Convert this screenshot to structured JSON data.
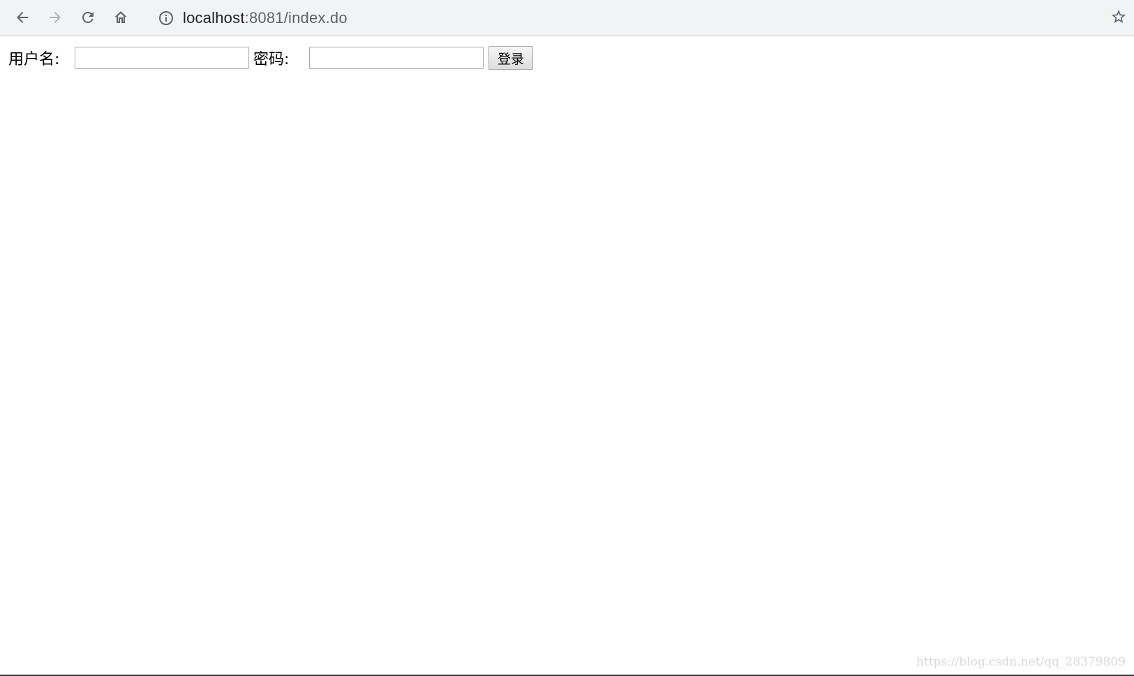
{
  "browser": {
    "url_host": "localhost",
    "url_rest": ":8081/index.do",
    "icons": {
      "back": "back-arrow-icon",
      "forward": "forward-arrow-icon",
      "reload": "reload-icon",
      "home": "home-icon",
      "site_info": "info-icon",
      "bookmark": "star-icon"
    }
  },
  "form": {
    "username_label": "用户名:",
    "username_value": "",
    "password_label": "密码:",
    "password_value": "",
    "login_button": "登录"
  },
  "watermark": "https://blog.csdn.net/qq_28379809",
  "colors": {
    "toolbar_bg": "#f1f3f4",
    "icon": "#5f6368",
    "icon_disabled": "#b0b3b7",
    "watermark": "#d9d9d9"
  }
}
